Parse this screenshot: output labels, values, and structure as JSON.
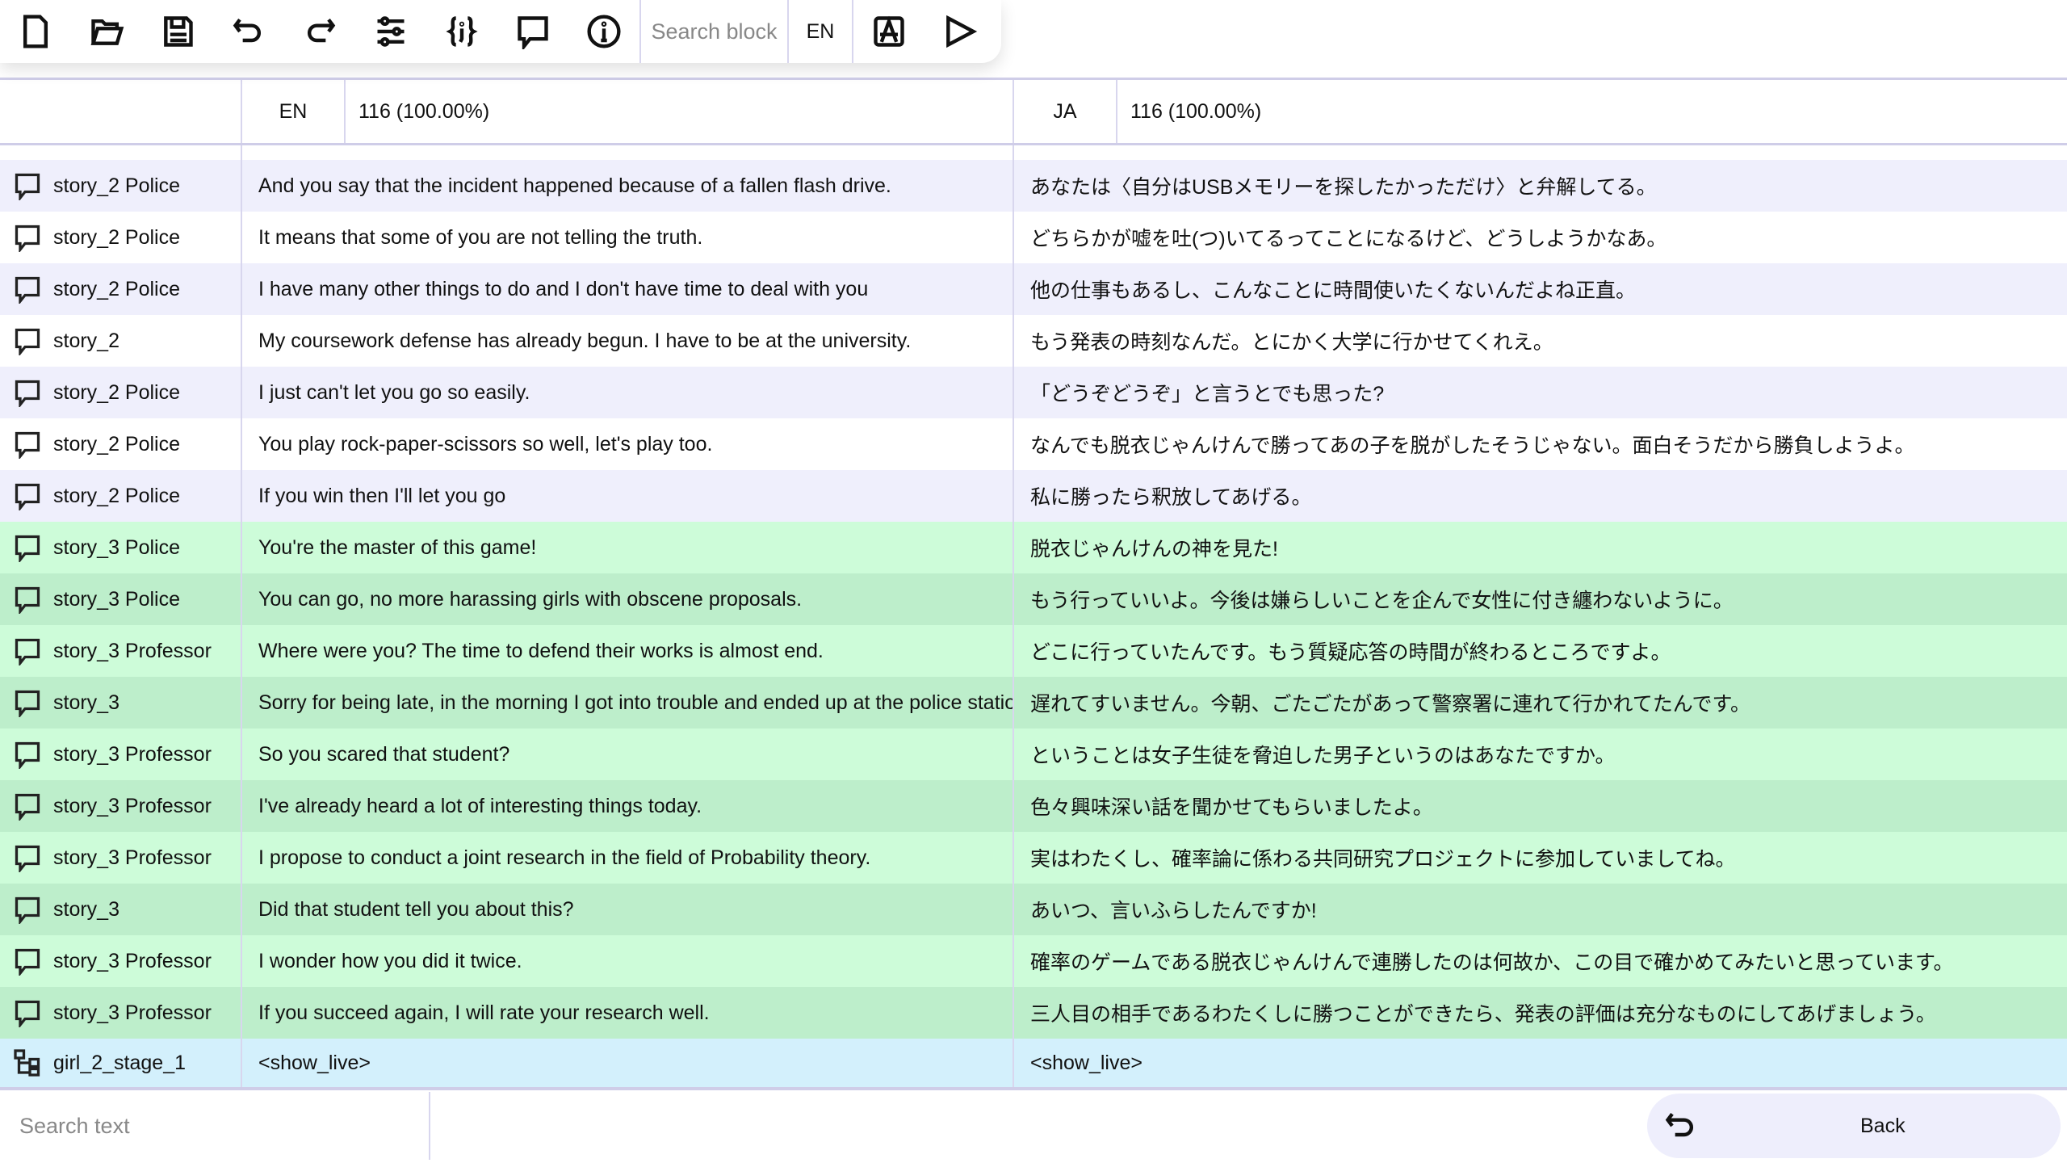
{
  "toolbar": {
    "icons": [
      "new-file-icon",
      "open-folder-icon",
      "save-icon",
      "undo-icon",
      "redo-icon",
      "settings-sliders-icon",
      "json-braces-icon",
      "comment-icon",
      "info-icon",
      "translate-icon",
      "play-icon"
    ],
    "search_placeholder": "Search block",
    "language": "EN"
  },
  "header": {
    "source_lang": "EN",
    "source_count": "116 (100.00%)",
    "target_lang": "JA",
    "target_count": "116 (100.00%)"
  },
  "rows": [
    {
      "speaker": "story_2 Police",
      "en": "And you say that the incident happened because of a fallen flash drive.",
      "ja": "あなたは〈自分はUSBメモリーを探したかっただけ〉と弁解してる。",
      "color": "purple"
    },
    {
      "speaker": "story_2 Police",
      "en": "It means that some of you are not telling the truth.",
      "ja": "どちらかが嘘を吐(つ)いてるってことになるけど、どうしようかなあ。",
      "color": "white"
    },
    {
      "speaker": "story_2 Police",
      "en": "I have many other things to do and I don't have time to deal with you",
      "ja": "他の仕事もあるし、こんなことに時間使いたくないんだよね正直。",
      "color": "purple"
    },
    {
      "speaker": "story_2",
      "en": "My coursework defense has already begun. I have to be at the university.",
      "ja": "もう発表の時刻なんだ。とにかく大学に行かせてくれえ。",
      "color": "white"
    },
    {
      "speaker": "story_2 Police",
      "en": "I just can't let you go so easily.",
      "ja": "「どうぞどうぞ」と言うとでも思った?",
      "color": "purple"
    },
    {
      "speaker": "story_2 Police",
      "en": "You play rock-paper-scissors so well, let's play too.",
      "ja": "なんでも脱衣じゃんけんで勝ってあの子を脱がしたそうじゃない。面白そうだから勝負しようよ。",
      "color": "white"
    },
    {
      "speaker": "story_2 Police",
      "en": "If you win then I'll let you go",
      "ja": "私に勝ったら釈放してあげる。",
      "color": "purple"
    },
    {
      "speaker": "story_3 Police",
      "en": "You're the master of this game!",
      "ja": "脱衣じゃんけんの神を見た!",
      "color": "g1"
    },
    {
      "speaker": "story_3 Police",
      "en": "You can go, no more harassing girls with obscene proposals.",
      "ja": "もう行っていいよ。今後は嫌らしいことを企んで女性に付き纏わないように。",
      "color": "g2"
    },
    {
      "speaker": "story_3 Professor",
      "en": "Where were you? The time to defend their works is almost end.",
      "ja": "どこに行っていたんです。もう質疑応答の時間が終わるところですよ。",
      "color": "g1"
    },
    {
      "speaker": "story_3",
      "en": "Sorry for being late, in the morning I got into trouble and ended up at the police station.",
      "ja": "遅れてすいません。今朝、ごたごたがあって警察署に連れて行かれてたんです。",
      "color": "g2"
    },
    {
      "speaker": "story_3 Professor",
      "en": "So you scared that student?",
      "ja": "ということは女子生徒を脅迫した男子というのはあなたですか。",
      "color": "g1"
    },
    {
      "speaker": "story_3 Professor",
      "en": "I've already heard a lot of interesting things today.",
      "ja": "色々興味深い話を聞かせてもらいましたよ。",
      "color": "g2"
    },
    {
      "speaker": "story_3 Professor",
      "en": "I propose to conduct a joint research in the field of Probability theory.",
      "ja": "実はわたくし、確率論に係わる共同研究プロジェクトに参加していましてね。",
      "color": "g1"
    },
    {
      "speaker": "story_3",
      "en": "Did that student tell you about this?",
      "ja": "あいつ、言いふらしたんですか!",
      "color": "g2"
    },
    {
      "speaker": "story_3 Professor",
      "en": "I wonder how you did it twice.",
      "ja": "確率のゲームである脱衣じゃんけんで連勝したのは何故か、この目で確かめてみたいと思っています。",
      "color": "g1"
    },
    {
      "speaker": "story_3 Professor",
      "en": "If you succeed again, I will rate your research well.",
      "ja": "三人目の相手であるわたくしに勝つことができたら、発表の評価は充分なものにしてあげましょう。",
      "color": "g2"
    },
    {
      "speaker": "girl_2_stage_1",
      "en": "<show_live>",
      "ja": "<show_live>",
      "color": "blue",
      "icon": "node-tree-icon"
    }
  ],
  "bottom": {
    "search_placeholder": "Search text",
    "back_label": "Back"
  },
  "colors": {
    "purple": "#efeffc",
    "g1": "#cdfcd9",
    "g2": "#bdeecb",
    "blue": "#d3f0fc"
  }
}
